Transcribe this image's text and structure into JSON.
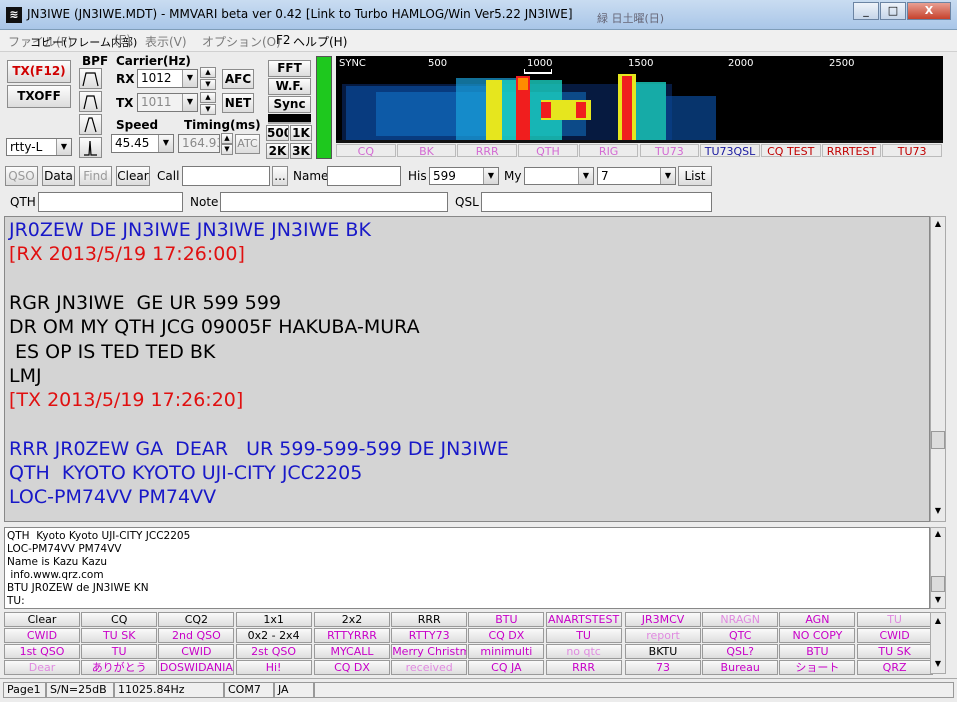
{
  "window": {
    "title": "JN3IWE (JN3IWE.MDT) - MMVARI beta ver 0.42 [Link to Turbo HAMLOG/Win Ver5.22 JN3IWE]",
    "controls": [
      "_",
      "□",
      "X"
    ],
    "bg_title": "緑 日土曜(日)"
  },
  "menu": [
    "ファイル(F)",
    "コピー(フレーム内部)",
    "(E)",
    "表示(V)",
    "オプション(O)",
    "F2",
    "ヘルプ(H)"
  ],
  "tx": {
    "txf12": "TX(F12)",
    "txoff": "TXOFF",
    "mode": "rtty-L"
  },
  "bpf": {
    "label": "BPF"
  },
  "carrier": {
    "label": "Carrier(Hz)",
    "rx_label": "RX",
    "rx_value": "1012",
    "tx_label": "TX",
    "tx_value": "1011",
    "afc": "AFC",
    "net": "NET"
  },
  "speed": {
    "label": "Speed",
    "value": "45.45"
  },
  "timing": {
    "label": "Timing(ms)",
    "value": "164.93",
    "atc": "ATC"
  },
  "view": {
    "fft": "FFT",
    "wf": "W.F.",
    "sync": "Sync",
    "b500": "500",
    "b1k": "1K",
    "b2k": "2K",
    "b3k": "3K"
  },
  "waterfall": {
    "sync": "SYNC",
    "ticks": [
      "500",
      "1000",
      "1500",
      "2000",
      "2500"
    ]
  },
  "macros_top": [
    {
      "t": "CQ",
      "c": "#d36ad3"
    },
    {
      "t": "BK",
      "c": "#d36ad3"
    },
    {
      "t": "RRR",
      "c": "#d36ad3"
    },
    {
      "t": "QTH",
      "c": "#d36ad3"
    },
    {
      "t": "RIG",
      "c": "#d36ad3"
    },
    {
      "t": "TU73",
      "c": "#d36ad3"
    },
    {
      "t": "TU73QSL",
      "c": "#1a1aa0"
    },
    {
      "t": "CQ TEST",
      "c": "#c00000"
    },
    {
      "t": "RRRTEST",
      "c": "#c00000"
    },
    {
      "t": "TU73",
      "c": "#c00000"
    }
  ],
  "log": {
    "qso": "QSO",
    "data": "Data",
    "find": "Find",
    "clear": "Clear",
    "call_label": "Call",
    "call_value": "",
    "ellipsis": "...",
    "name_label": "Name",
    "name_value": "",
    "his_label": "His",
    "his_value": "599",
    "my_label": "My",
    "my_value": "",
    "band_value": "7",
    "list": "List",
    "qth_label": "QTH",
    "qth_value": "",
    "note_label": "Note",
    "note_value": "",
    "qsl_label": "QSL",
    "qsl_value": ""
  },
  "rx_lines": [
    {
      "t": "JR0ZEW DE JN3IWE JN3IWE JN3IWE BK",
      "c": "#1818c8"
    },
    {
      "t": "[RX 2013/5/19 17:26:00]",
      "c": "#e01010"
    },
    {
      "t": "",
      "c": "#000"
    },
    {
      "t": "RGR JN3IWE  GE UR 599 599",
      "c": "#000000"
    },
    {
      "t": "DR OM MY QTH JCG 09005F HAKUBA-MURA",
      "c": "#000000"
    },
    {
      "t": " ES OP IS TED TED BK",
      "c": "#000000"
    },
    {
      "t": "LMJ",
      "c": "#000000"
    },
    {
      "t": "[TX 2013/5/19 17:26:20]",
      "c": "#e01010"
    },
    {
      "t": "",
      "c": "#000"
    },
    {
      "t": "RRR JR0ZEW GA  DEAR   UR 599-599-599 DE JN3IWE",
      "c": "#1818c8"
    },
    {
      "t": "QTH  KYOTO KYOTO UJI-CITY JCC2205",
      "c": "#1818c8"
    },
    {
      "t": "LOC-PM74VV PM74VV",
      "c": "#1818c8"
    }
  ],
  "tx_lines": [
    "QTH  Kyoto Kyoto UJI-CITY JCC2205",
    "LOC-PM74VV PM74VV",
    "Name is Kazu Kazu",
    " info.www.qrz.com",
    "BTU JR0ZEW de JN3IWE KN",
    "TU:"
  ],
  "macro_grid": {
    "bank1": [
      [
        {
          "t": "Clear",
          "c": "#000"
        },
        {
          "t": "CQ",
          "c": "#000"
        },
        {
          "t": "CQ2",
          "c": "#000"
        },
        {
          "t": "1x1",
          "c": "#000"
        }
      ],
      [
        {
          "t": "CWID",
          "c": "#c800c8"
        },
        {
          "t": "TU SK",
          "c": "#c800c8"
        },
        {
          "t": "2nd QSO",
          "c": "#c800c8"
        },
        {
          "t": "0x2 - 2x4",
          "c": "#000"
        }
      ],
      [
        {
          "t": "1st QSO",
          "c": "#c800c8"
        },
        {
          "t": "TU",
          "c": "#c800c8"
        },
        {
          "t": "CWID",
          "c": "#c800c8"
        },
        {
          "t": "2st QSO",
          "c": "#c800c8"
        }
      ],
      [
        {
          "t": "Dear",
          "c": "#e08ae0"
        },
        {
          "t": "ありがとう",
          "c": "#c800c8"
        },
        {
          "t": "DOSWIDANIA",
          "c": "#c800c8"
        },
        {
          "t": "Hi!",
          "c": "#c800c8"
        }
      ]
    ],
    "bank2": [
      [
        {
          "t": "2x2",
          "c": "#000"
        },
        {
          "t": "RRR",
          "c": "#000"
        },
        {
          "t": "BTU",
          "c": "#c800c8"
        },
        {
          "t": "ANARTSTEST",
          "c": "#c800c8"
        }
      ],
      [
        {
          "t": "RTTYRRR",
          "c": "#c800c8"
        },
        {
          "t": "RTTY73",
          "c": "#c800c8"
        },
        {
          "t": "CQ DX",
          "c": "#c800c8"
        },
        {
          "t": "TU",
          "c": "#c800c8"
        }
      ],
      [
        {
          "t": "MYCALL",
          "c": "#c800c8"
        },
        {
          "t": "Merry Christmas",
          "c": "#c800c8"
        },
        {
          "t": "minimulti",
          "c": "#c800c8"
        },
        {
          "t": "no qtc",
          "c": "#e08ae0"
        }
      ],
      [
        {
          "t": "CQ DX",
          "c": "#c800c8"
        },
        {
          "t": "received",
          "c": "#e08ae0"
        },
        {
          "t": "CQ JA",
          "c": "#c800c8"
        },
        {
          "t": "RRR",
          "c": "#c800c8"
        }
      ]
    ],
    "bank3": [
      [
        {
          "t": "JR3MCV",
          "c": "#c800c8"
        },
        {
          "t": "NRAGN",
          "c": "#e08ae0"
        },
        {
          "t": "AGN",
          "c": "#c800c8"
        },
        {
          "t": "TU",
          "c": "#e08ae0"
        }
      ],
      [
        {
          "t": "report",
          "c": "#e08ae0"
        },
        {
          "t": "QTC",
          "c": "#c800c8"
        },
        {
          "t": "NO COPY",
          "c": "#c800c8"
        },
        {
          "t": "CWID",
          "c": "#c800c8"
        }
      ],
      [
        {
          "t": "BKTU",
          "c": "#000"
        },
        {
          "t": "QSL?",
          "c": "#c800c8"
        },
        {
          "t": "BTU",
          "c": "#c800c8"
        },
        {
          "t": "TU SK",
          "c": "#c800c8"
        }
      ],
      [
        {
          "t": "73",
          "c": "#c800c8"
        },
        {
          "t": "Bureau",
          "c": "#c800c8"
        },
        {
          "t": "ショート",
          "c": "#c800c8"
        },
        {
          "t": "QRZ",
          "c": "#c800c8"
        }
      ]
    ]
  },
  "status": {
    "page": "Page1",
    "sn": "S/N=25dB",
    "clock": "11025.84Hz",
    "port": "COM7",
    "lang": "JA"
  }
}
